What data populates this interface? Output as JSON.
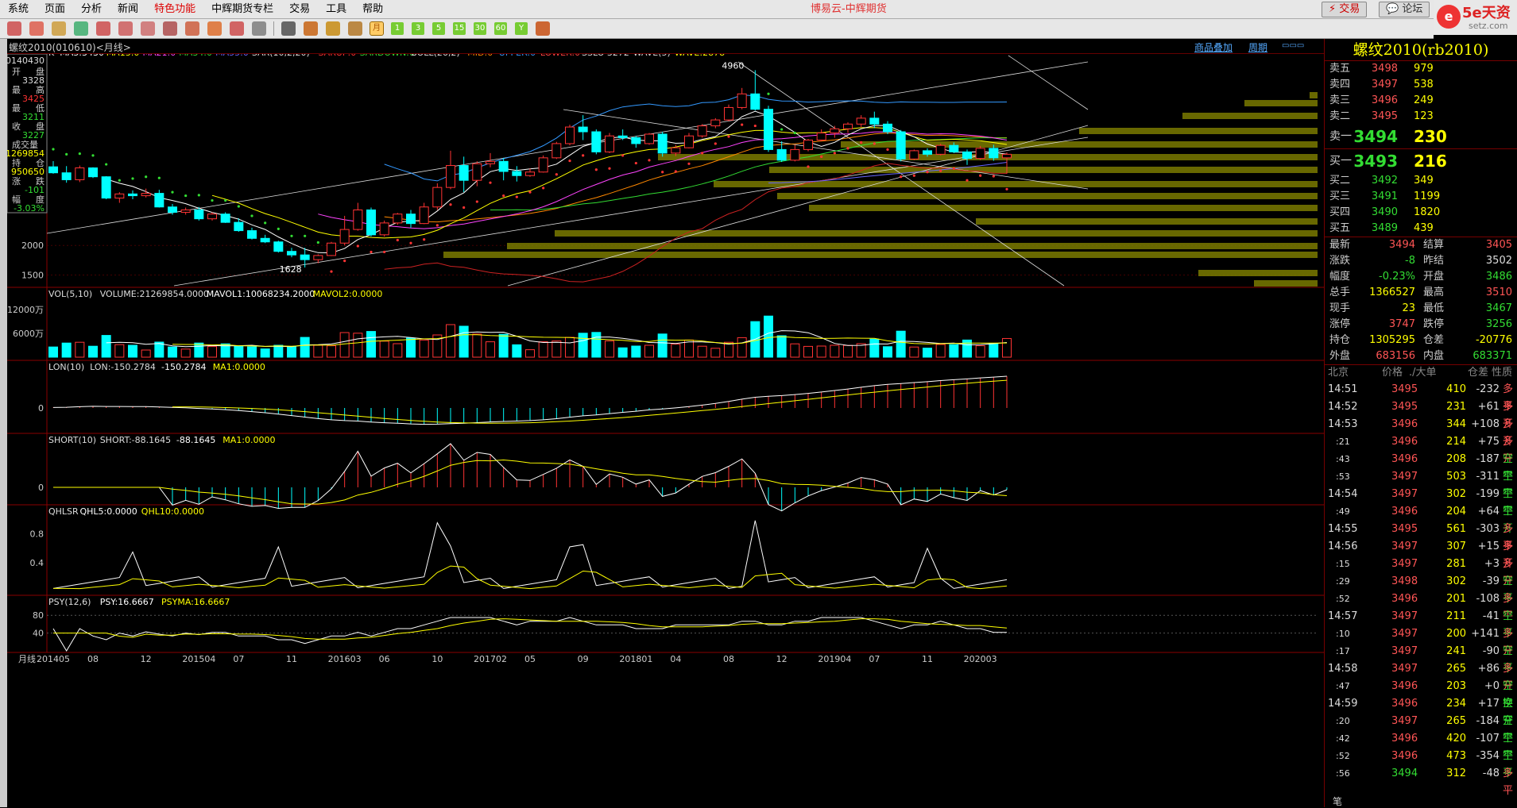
{
  "menubar": {
    "items": [
      "系统",
      "页面",
      "分析",
      "新闻",
      "特色功能",
      "中辉期货专栏",
      "交易",
      "工具",
      "帮助"
    ]
  },
  "title": "博易云-中辉期货",
  "topbar": {
    "trade": "交易",
    "forum": "论坛"
  },
  "logo": {
    "main": "5e天资",
    "sub": "setz.com"
  },
  "toolbar": {
    "labels": [
      "月",
      "1",
      "3",
      "5",
      "15",
      "30",
      "60"
    ],
    "y_label": "Y"
  },
  "header": {
    "symbol": "螺纹2010(010610)<月线>",
    "product_add": "商品叠加",
    "period": "周期"
  },
  "info": {
    "date": "20140430",
    "rows": [
      [
        "开",
        "盘",
        "3328"
      ],
      [
        "最",
        "高",
        "3425"
      ],
      [
        "最",
        "低",
        "3211"
      ],
      [
        "收",
        "盘",
        "3227"
      ],
      [
        "成交量",
        "",
        "21269854"
      ],
      [
        "持",
        "仓",
        "950650"
      ],
      [
        "涨",
        "跌",
        "-101"
      ],
      [
        "幅",
        "度",
        "-3.03%"
      ]
    ]
  },
  "main_indicators": [
    {
      "t": "K",
      "c": "#ddd"
    },
    {
      "t": "MA5:3430",
      "c": "#fff"
    },
    {
      "t": "MA13:0",
      "c": "#ff0"
    },
    {
      "t": "MA21:0",
      "c": "#f4f"
    },
    {
      "t": "MA34:0",
      "c": "#3d3"
    },
    {
      "t": "MA55:0",
      "c": "#66f"
    },
    {
      "t": "SAR(10,2,20)",
      "c": "#ddd"
    },
    {
      "t": "SARUP:0",
      "c": "#f33"
    },
    {
      "t": "SARDOWN:0",
      "c": "#3d3"
    },
    {
      "t": "BOLL(26,2)",
      "c": "#ddd"
    },
    {
      "t": "MID:0",
      "c": "#f80"
    },
    {
      "t": "UPPER:0",
      "c": "#39f"
    },
    {
      "t": "LOWER:0",
      "c": "#f44"
    },
    {
      "t": "SSLO 3272",
      "c": "#ddd"
    },
    {
      "t": "WAVE(5)",
      "c": "#ddd"
    },
    {
      "t": "WAVE:2878",
      "c": "#ff0"
    }
  ],
  "main_ticks": [
    "2000",
    "1500"
  ],
  "main_annotations": {
    "high": "4960",
    "low": "1628"
  },
  "vol": {
    "indicators": [
      {
        "t": "VOL(5,10)",
        "c": "#ddd"
      },
      {
        "t": "VOLUME:21269854.0000",
        "c": "#ddd"
      },
      {
        "t": "MAVOL1:10068234.2000",
        "c": "#fff"
      },
      {
        "t": "MAVOL2:0.0000",
        "c": "#ff0"
      }
    ],
    "ticks": [
      "12000万",
      "6000万"
    ]
  },
  "lon": {
    "indicators": [
      {
        "t": "LON(10)",
        "c": "#ddd"
      },
      {
        "t": "LON:-150.2784",
        "c": "#ddd"
      },
      {
        "t": "-150.2784",
        "c": "#fff"
      },
      {
        "t": "MA1:0.0000",
        "c": "#ff0"
      }
    ],
    "ticks": [
      "0"
    ]
  },
  "short": {
    "indicators": [
      {
        "t": "SHORT(10)",
        "c": "#ddd"
      },
      {
        "t": "SHORT:-88.1645",
        "c": "#ddd"
      },
      {
        "t": "-88.1645",
        "c": "#fff"
      },
      {
        "t": "MA1:0.0000",
        "c": "#ff0"
      }
    ],
    "ticks": [
      "0"
    ]
  },
  "qhlsr": {
    "indicators": [
      {
        "t": "QHLSR",
        "c": "#ddd"
      },
      {
        "t": "QHL5:0.0000",
        "c": "#fff"
      },
      {
        "t": "QHL10:0.0000",
        "c": "#ff0"
      }
    ],
    "ticks": [
      "0.8",
      "0.4"
    ]
  },
  "psy": {
    "indicators": [
      {
        "t": "PSY(12,6)",
        "c": "#ddd"
      },
      {
        "t": "PSY:16.6667",
        "c": "#fff"
      },
      {
        "t": "PSYMA:16.6667",
        "c": "#ff0"
      }
    ],
    "ticks": [
      "80",
      "40"
    ]
  },
  "xaxis": {
    "label": "月线",
    "ticks": [
      "201405",
      "08",
      "12",
      "201504",
      "07",
      "11",
      "201603",
      "06",
      "10",
      "201702",
      "05",
      "09",
      "201801",
      "04",
      "08",
      "12",
      "201904",
      "07",
      "11",
      "202003"
    ]
  },
  "right_panel": {
    "title": "螺纹2010(rb2010)",
    "asks": [
      {
        "label": "卖五",
        "price": "3498",
        "vol": "979"
      },
      {
        "label": "卖四",
        "price": "3497",
        "vol": "538"
      },
      {
        "label": "卖三",
        "price": "3496",
        "vol": "249"
      },
      {
        "label": "卖二",
        "price": "3495",
        "vol": "123"
      },
      {
        "label": "卖一",
        "price": "3494",
        "vol": "230"
      }
    ],
    "bids": [
      {
        "label": "买一",
        "price": "3493",
        "vol": "216"
      },
      {
        "label": "买二",
        "price": "3492",
        "vol": "349"
      },
      {
        "label": "买三",
        "price": "3491",
        "vol": "1199"
      },
      {
        "label": "买四",
        "price": "3490",
        "vol": "1820"
      },
      {
        "label": "买五",
        "price": "3489",
        "vol": "439"
      }
    ],
    "stats": [
      [
        "最新",
        "3494",
        "#ff5555",
        "结算",
        "3405",
        "#ff5555"
      ],
      [
        "涨跌",
        "-8",
        "#3d3",
        "昨结",
        "3502",
        "#ddd"
      ],
      [
        "幅度",
        "-0.23%",
        "#3d3",
        "开盘",
        "3486",
        "#3d3"
      ],
      [
        "总手",
        "1366527",
        "#ff0",
        "最高",
        "3510",
        "#ff5555"
      ],
      [
        "现手",
        "23",
        "#ff0",
        "最低",
        "3467",
        "#3d3"
      ],
      [
        "涨停",
        "3747",
        "#ff5555",
        "跌停",
        "3256",
        "#3d3"
      ],
      [
        "持仓",
        "1305295",
        "#ff0",
        "仓差",
        "-20776",
        "#ff0"
      ],
      [
        "外盘",
        "683156",
        "#ff5555",
        "内盘",
        "683371",
        "#3d3"
      ]
    ],
    "trades_header": [
      "北京",
      "价格",
      "./大单",
      "仓差",
      "性质"
    ],
    "trades": [
      [
        "14:51",
        "3495",
        "410",
        "-232",
        "多平"
      ],
      [
        "14:52",
        "3495",
        "231",
        "+61",
        "多开"
      ],
      [
        "14:53",
        "3496",
        "344",
        "+108",
        "多开"
      ],
      [
        ":21",
        "3496",
        "214",
        "+75",
        "多开"
      ],
      [
        ":43",
        "3496",
        "208",
        "-187",
        "空平"
      ],
      [
        ":53",
        "3497",
        "503",
        "-311",
        "空平"
      ],
      [
        "14:54",
        "3497",
        "302",
        "-199",
        "空平"
      ],
      [
        ":49",
        "3496",
        "204",
        "+64",
        "空开"
      ],
      [
        "14:55",
        "3495",
        "561",
        "-303",
        "多平"
      ],
      [
        "14:56",
        "3497",
        "307",
        "+15",
        "多开"
      ],
      [
        ":15",
        "3497",
        "281",
        "+3",
        "多开"
      ],
      [
        ":29",
        "3498",
        "302",
        "-39",
        "空平"
      ],
      [
        ":52",
        "3496",
        "201",
        "-108",
        "多平"
      ],
      [
        "14:57",
        "3497",
        "211",
        "-41",
        "空平"
      ],
      [
        ":10",
        "3497",
        "200",
        "+141",
        "多开"
      ],
      [
        ":17",
        "3497",
        "241",
        "-90",
        "空平"
      ],
      [
        "14:58",
        "3497",
        "265",
        "+86",
        "多开"
      ],
      [
        ":47",
        "3496",
        "203",
        "+0",
        "空换"
      ],
      [
        "14:59",
        "3496",
        "234",
        "+17",
        "空开"
      ],
      [
        ":20",
        "3497",
        "265",
        "-184",
        "空平"
      ],
      [
        ":42",
        "3496",
        "420",
        "-107",
        "空平"
      ],
      [
        ":52",
        "3496",
        "473",
        "-354",
        "空平"
      ],
      [
        ":56",
        "3494",
        "312",
        "-48",
        "多平"
      ]
    ],
    "footer_label": "笔"
  },
  "chart_data": {
    "type": "candlestick",
    "period": "月线",
    "x": [
      "201405",
      "201406",
      "201407",
      "201408",
      "201409",
      "201410",
      "201411",
      "201412",
      "201501",
      "201502",
      "201503",
      "201504",
      "201505",
      "201506",
      "201507",
      "201508",
      "201509",
      "201510",
      "201511",
      "201512",
      "201601",
      "201602",
      "201603",
      "201604",
      "201605",
      "201606",
      "201607",
      "201608",
      "201609",
      "201610",
      "201611",
      "201612",
      "201701",
      "201702",
      "201703",
      "201704",
      "201705",
      "201706",
      "201707",
      "201708",
      "201709",
      "201710",
      "201711",
      "201712",
      "201801",
      "201802",
      "201803",
      "201804",
      "201805",
      "201806",
      "201807",
      "201808",
      "201809",
      "201810",
      "201811",
      "201812",
      "201901",
      "201902",
      "201903",
      "201904",
      "201905",
      "201906",
      "201907",
      "201908",
      "201909",
      "201910",
      "201911",
      "201912",
      "202001",
      "202002",
      "202003",
      "202004",
      "202005"
    ],
    "ohlc": [
      [
        3328,
        3425,
        3211,
        3227
      ],
      [
        3227,
        3340,
        3060,
        3110
      ],
      [
        3110,
        3350,
        3070,
        3310
      ],
      [
        3310,
        3320,
        3140,
        3160
      ],
      [
        3160,
        3170,
        2780,
        2800
      ],
      [
        2800,
        2900,
        2720,
        2870
      ],
      [
        2870,
        2930,
        2780,
        2840
      ],
      [
        2840,
        2960,
        2810,
        2880
      ],
      [
        2880,
        2940,
        2640,
        2650
      ],
      [
        2650,
        2700,
        2520,
        2560
      ],
      [
        2560,
        2640,
        2520,
        2600
      ],
      [
        2600,
        2650,
        2420,
        2450
      ],
      [
        2450,
        2560,
        2420,
        2530
      ],
      [
        2530,
        2560,
        2380,
        2390
      ],
      [
        2390,
        2460,
        2230,
        2250
      ],
      [
        2250,
        2300,
        2100,
        2120
      ],
      [
        2120,
        2180,
        2040,
        2060
      ],
      [
        2060,
        2080,
        1880,
        1900
      ],
      [
        1900,
        1960,
        1800,
        1840
      ],
      [
        1840,
        1960,
        1628,
        1760
      ],
      [
        1760,
        1850,
        1700,
        1830
      ],
      [
        1830,
        2060,
        1820,
        2040
      ],
      [
        2040,
        2500,
        2000,
        2270
      ],
      [
        2270,
        2720,
        2250,
        2600
      ],
      [
        2600,
        2640,
        2150,
        2180
      ],
      [
        2180,
        2420,
        2150,
        2380
      ],
      [
        2380,
        2550,
        2350,
        2530
      ],
      [
        2530,
        2600,
        2300,
        2370
      ],
      [
        2370,
        2720,
        2360,
        2650
      ],
      [
        2650,
        3050,
        2600,
        2980
      ],
      [
        2980,
        3600,
        2950,
        3350
      ],
      [
        3350,
        3500,
        2900,
        3100
      ],
      [
        3100,
        3420,
        3000,
        3380
      ],
      [
        3380,
        3560,
        3320,
        3420
      ],
      [
        3420,
        3480,
        3100,
        3250
      ],
      [
        3250,
        3340,
        3080,
        3180
      ],
      [
        3180,
        3300,
        3160,
        3240
      ],
      [
        3240,
        3520,
        3230,
        3480
      ],
      [
        3480,
        3750,
        3460,
        3720
      ],
      [
        3720,
        4040,
        3690,
        4000
      ],
      [
        4000,
        4200,
        3780,
        3920
      ],
      [
        3920,
        3960,
        3540,
        3580
      ],
      [
        3580,
        3900,
        3560,
        3850
      ],
      [
        3850,
        3960,
        3780,
        3820
      ],
      [
        3820,
        3850,
        3650,
        3720
      ],
      [
        3720,
        3900,
        3700,
        3880
      ],
      [
        3880,
        3920,
        3500,
        3560
      ],
      [
        3560,
        3700,
        3510,
        3650
      ],
      [
        3650,
        3900,
        3640,
        3850
      ],
      [
        3850,
        4050,
        3820,
        4020
      ],
      [
        4020,
        4150,
        3980,
        4120
      ],
      [
        4120,
        4380,
        4100,
        4330
      ],
      [
        4330,
        4660,
        4300,
        4560
      ],
      [
        4560,
        4960,
        4280,
        4300
      ],
      [
        4300,
        4360,
        3580,
        3620
      ],
      [
        3620,
        3760,
        3410,
        3440
      ],
      [
        3440,
        3700,
        3420,
        3620
      ],
      [
        3620,
        3800,
        3590,
        3780
      ],
      [
        3780,
        3960,
        3760,
        3900
      ],
      [
        3900,
        4020,
        3820,
        3970
      ],
      [
        3970,
        4080,
        3900,
        4050
      ],
      [
        4050,
        4200,
        4000,
        4150
      ],
      [
        4150,
        4260,
        3980,
        4050
      ],
      [
        4050,
        4100,
        3880,
        3920
      ],
      [
        3920,
        3950,
        3420,
        3460
      ],
      [
        3460,
        3620,
        3440,
        3600
      ],
      [
        3600,
        3640,
        3500,
        3540
      ],
      [
        3540,
        3720,
        3520,
        3690
      ],
      [
        3690,
        3740,
        3560,
        3580
      ],
      [
        3580,
        3620,
        3360,
        3470
      ],
      [
        3470,
        3680,
        3440,
        3640
      ],
      [
        3640,
        3700,
        3430,
        3480
      ],
      [
        3480,
        3570,
        3211,
        3540
      ]
    ],
    "yrange": [
      1400,
      5100
    ],
    "ticks_shown": [
      1500,
      2000
    ]
  }
}
